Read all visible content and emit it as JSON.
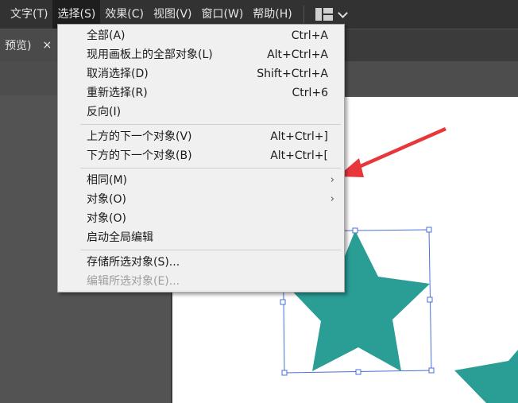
{
  "menubar": {
    "items": [
      "文字(T)",
      "选择(S)",
      "效果(C)",
      "视图(V)",
      "窗口(W)",
      "帮助(H)"
    ],
    "active_index": 1,
    "workspace_icon": "grid-layout-icon",
    "chevron_icon": "chevron-down-icon"
  },
  "tab": {
    "title": "预览)",
    "close": "×"
  },
  "select_menu": {
    "items": [
      {
        "label": "全部(A)",
        "shortcut": "Ctrl+A"
      },
      {
        "label": "现用画板上的全部对象(L)",
        "shortcut": "Alt+Ctrl+A"
      },
      {
        "label": "取消选择(D)",
        "shortcut": "Shift+Ctrl+A"
      },
      {
        "label": "重新选择(R)",
        "shortcut": "Ctrl+6"
      },
      {
        "label": "反向(I)",
        "shortcut": ""
      },
      {
        "label": "上方的下一个对象(V)",
        "shortcut": "Alt+Ctrl+]"
      },
      {
        "label": "下方的下一个对象(B)",
        "shortcut": "Alt+Ctrl+["
      },
      {
        "label": "相同(M)",
        "submenu": true
      },
      {
        "label": "对象(O)",
        "submenu": true
      },
      {
        "label": "对象(O)",
        "submenu": false
      },
      {
        "label": "启动全局编辑",
        "shortcut": ""
      },
      {
        "label": "存储所选对象(S)...",
        "shortcut": ""
      },
      {
        "label": "编辑所选对象(E)...",
        "shortcut": "",
        "disabled": true
      }
    ],
    "submenu_arrow": "›"
  },
  "canvas": {
    "star_color": "#2a9d94",
    "selection_color": "#4a6fd8",
    "annotation_arrow_color": "#e8373b"
  }
}
